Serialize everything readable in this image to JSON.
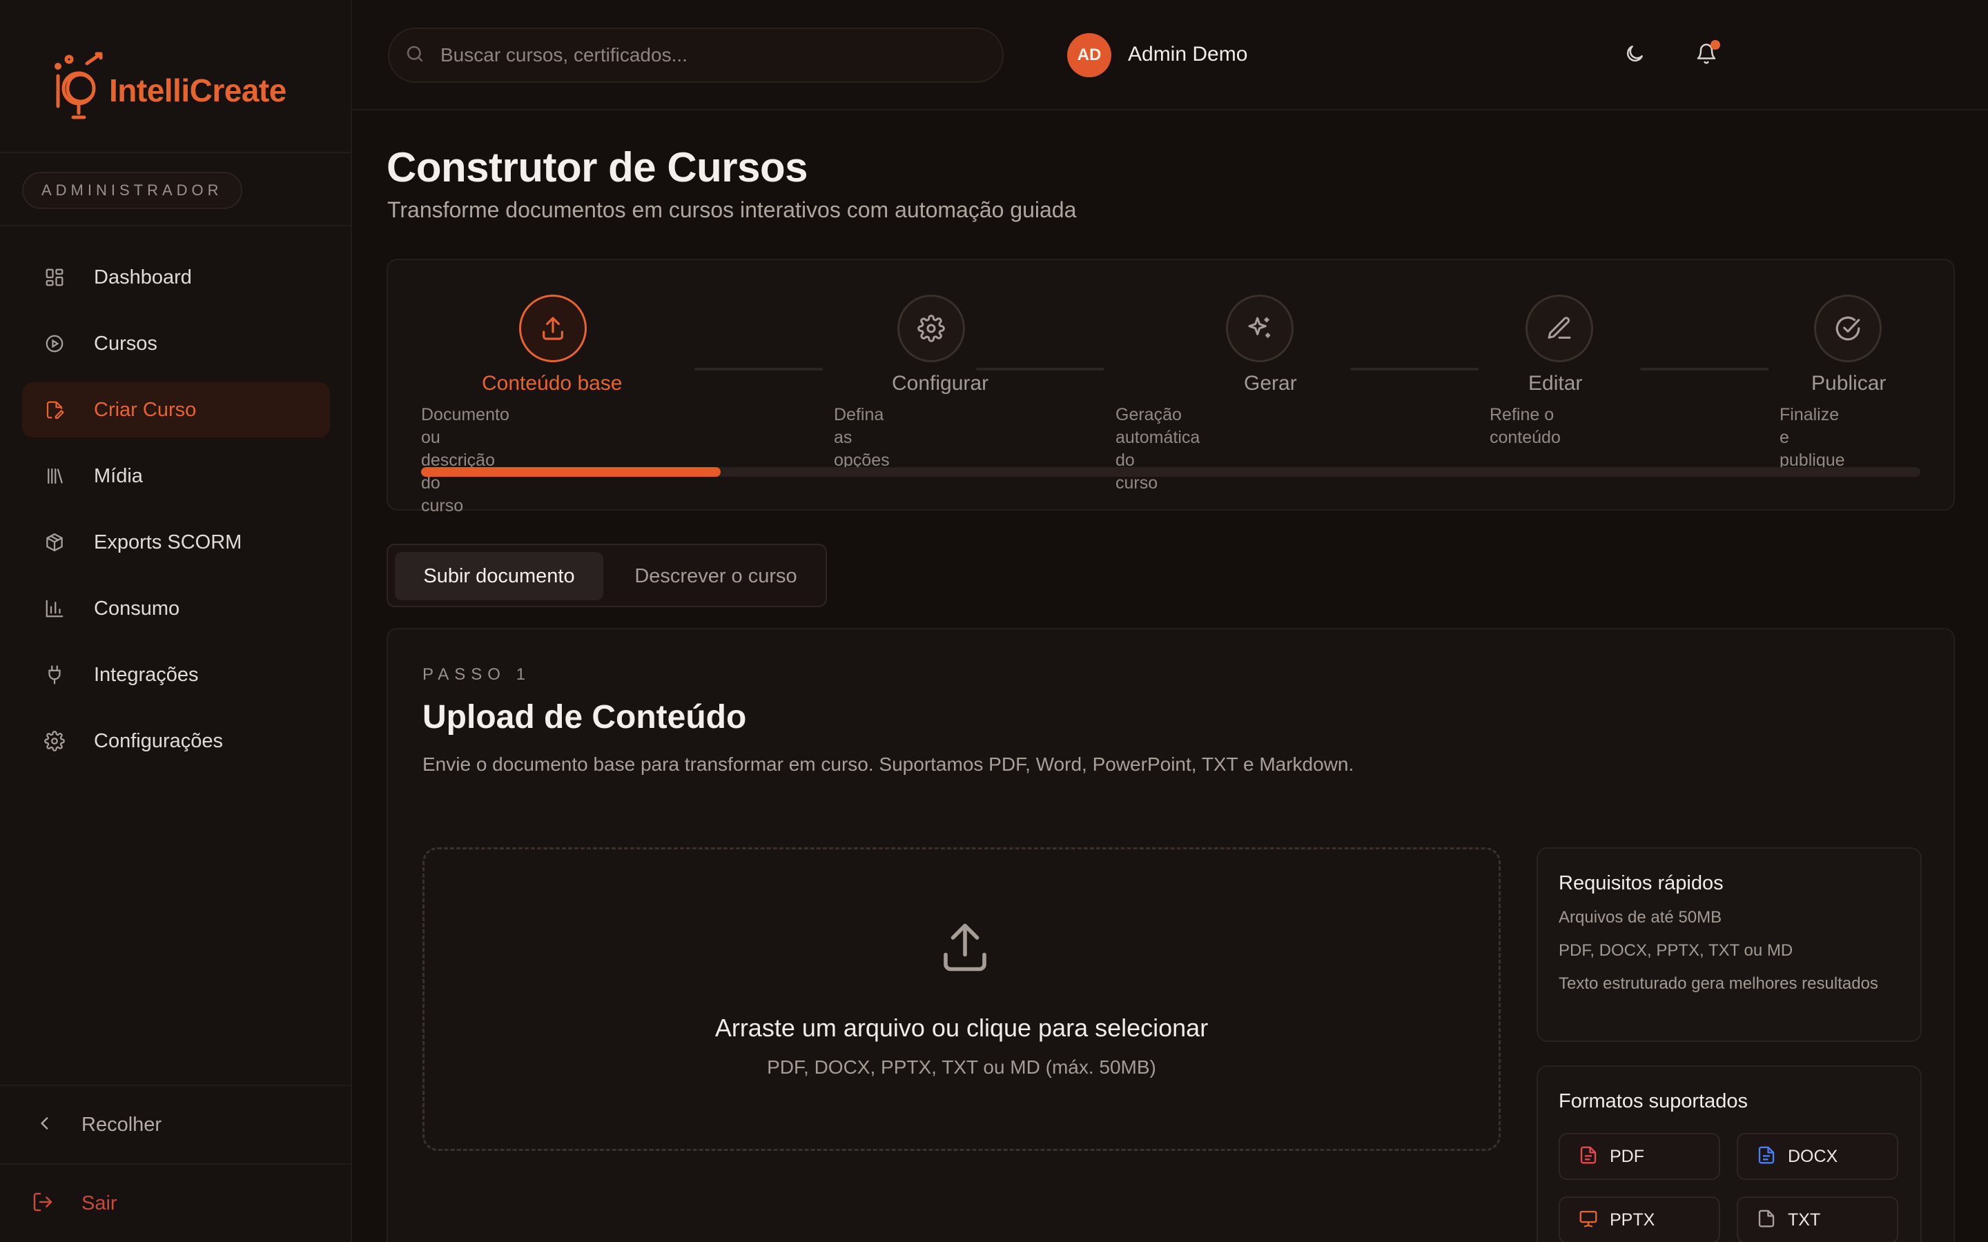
{
  "brand": {
    "name": "IntelliCreate",
    "accent": "#e8642e"
  },
  "sidebar": {
    "role": "ADMINISTRADOR",
    "items": [
      {
        "label": "Dashboard",
        "icon": "dashboard-icon",
        "active": false
      },
      {
        "label": "Cursos",
        "icon": "play-circle-icon",
        "active": false
      },
      {
        "label": "Criar Curso",
        "icon": "file-edit-icon",
        "active": true
      },
      {
        "label": "Mídia",
        "icon": "library-icon",
        "active": false
      },
      {
        "label": "Exports SCORM",
        "icon": "package-icon",
        "active": false
      },
      {
        "label": "Consumo",
        "icon": "bar-chart-icon",
        "active": false
      },
      {
        "label": "Integrações",
        "icon": "plug-icon",
        "active": false
      },
      {
        "label": "Configurações",
        "icon": "gear-icon",
        "active": false
      }
    ],
    "collapse_label": "Recolher",
    "logout_label": "Sair"
  },
  "header": {
    "search_placeholder": "Buscar cursos, certificados...",
    "user": {
      "initials": "AD",
      "name": "Admin Demo"
    }
  },
  "page": {
    "title": "Construtor de Cursos",
    "subtitle": "Transforme documentos em cursos interativos com automação guiada"
  },
  "stepper": {
    "progress": 0.2,
    "steps": [
      {
        "title": "Conteúdo base",
        "desc_lines": [
          "Documento ou descrição do",
          "curso"
        ],
        "icon": "upload-icon",
        "active": true
      },
      {
        "title": "Configurar",
        "desc_lines": [
          "Defina as",
          "opções"
        ],
        "icon": "gear-icon",
        "active": false
      },
      {
        "title": "Gerar",
        "desc_lines": [
          "Geração automática do",
          "curso"
        ],
        "icon": "sparkles-icon",
        "active": false
      },
      {
        "title": "Editar",
        "desc_lines": [
          "Refine o",
          "conteúdo"
        ],
        "icon": "pencil-icon",
        "active": false
      },
      {
        "title": "Publicar",
        "desc_lines": [
          "Finalize e",
          "publique"
        ],
        "icon": "check-circle-icon",
        "active": false
      }
    ]
  },
  "tabs": [
    {
      "label": "Subir documento",
      "active": true
    },
    {
      "label": "Descrever o curso",
      "active": false
    }
  ],
  "upload": {
    "eyebrow": "PASSO 1",
    "title": "Upload de Conteúdo",
    "description": "Envie o documento base para transformar em curso. Suportamos PDF, Word, PowerPoint, TXT e Markdown.",
    "dropzone_title": "Arraste um arquivo ou clique para selecionar",
    "dropzone_sub": "PDF, DOCX, PPTX, TXT ou MD (máx. 50MB)"
  },
  "requirements": {
    "title": "Requisitos rápidos",
    "items": [
      "Arquivos de até 50MB",
      "PDF, DOCX, PPTX, TXT ou MD",
      "Texto estruturado gera melhores resultados"
    ]
  },
  "formats": {
    "title": "Formatos suportados",
    "items": [
      {
        "label": "PDF",
        "color": "#e5484d"
      },
      {
        "label": "DOCX",
        "color": "#4c7ef3"
      },
      {
        "label": "PPTX",
        "color": "#e8642e"
      },
      {
        "label": "TXT",
        "color": "#a9a09b"
      }
    ]
  }
}
